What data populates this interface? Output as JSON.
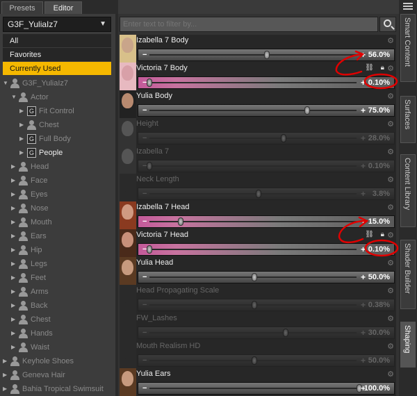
{
  "tabs": [
    "Presets",
    "Editor"
  ],
  "figure_selector": {
    "value": "G3F_YuliaIz7"
  },
  "filters": [
    "All",
    "Favorites",
    "Currently Used"
  ],
  "tree": [
    {
      "label": "G3F_YuliaIz7"
    },
    {
      "label": "Actor"
    },
    {
      "label": "Fit Control"
    },
    {
      "label": "Chest"
    },
    {
      "label": "Full Body"
    },
    {
      "label": "People"
    },
    {
      "label": "Head"
    },
    {
      "label": "Face"
    },
    {
      "label": "Eyes"
    },
    {
      "label": "Nose"
    },
    {
      "label": "Mouth"
    },
    {
      "label": "Ears"
    },
    {
      "label": "Hip"
    },
    {
      "label": "Legs"
    },
    {
      "label": "Feet"
    },
    {
      "label": "Arms"
    },
    {
      "label": "Back"
    },
    {
      "label": "Chest"
    },
    {
      "label": "Hands"
    },
    {
      "label": "Waist"
    },
    {
      "label": "Keyhole Shoes"
    },
    {
      "label": "Geneva Hair"
    },
    {
      "label": "Bahia Tropical Swimsuit"
    }
  ],
  "search": {
    "placeholder": "Enter text to filter by..."
  },
  "properties": [
    {
      "name": "Izabella 7 Body",
      "value": "56.0%",
      "fraction": 0.56
    },
    {
      "name": "Victoria 7 Body",
      "value": "0.10%",
      "fraction": 0.0
    },
    {
      "name": "Yulia Body",
      "value": "75.0%",
      "fraction": 0.75
    },
    {
      "name": "Height",
      "value": "28.0%",
      "fraction": 0.64
    },
    {
      "name": "Izabella 7",
      "value": "0.10%",
      "fraction": 0.0
    },
    {
      "name": "Neck Length",
      "value": "3.8%",
      "fraction": 0.52
    },
    {
      "name": "Izabella 7 Head",
      "value": "15.0%",
      "fraction": 0.15
    },
    {
      "name": "Victoria 7 Head",
      "value": "0.10%",
      "fraction": 0.0
    },
    {
      "name": "Yulia Head",
      "value": "50.0%",
      "fraction": 0.5
    },
    {
      "name": "Head Propagating Scale",
      "value": "0.38%",
      "fraction": 0.5
    },
    {
      "name": "FW_Lashes",
      "value": "30.0%",
      "fraction": 0.65
    },
    {
      "name": "Mouth Realism HD",
      "value": "50.0%",
      "fraction": 0.5
    },
    {
      "name": "Yulia Ears",
      "value": "100.0%",
      "fraction": 1.0
    }
  ],
  "side_tabs": [
    "Smart Content",
    "Surfaces",
    "Content Library",
    "Shader Builder",
    "Shaping"
  ],
  "colors": {
    "accent": "#f5b800",
    "annotation": "#e00000",
    "pink_bar": "#c45a9a"
  }
}
